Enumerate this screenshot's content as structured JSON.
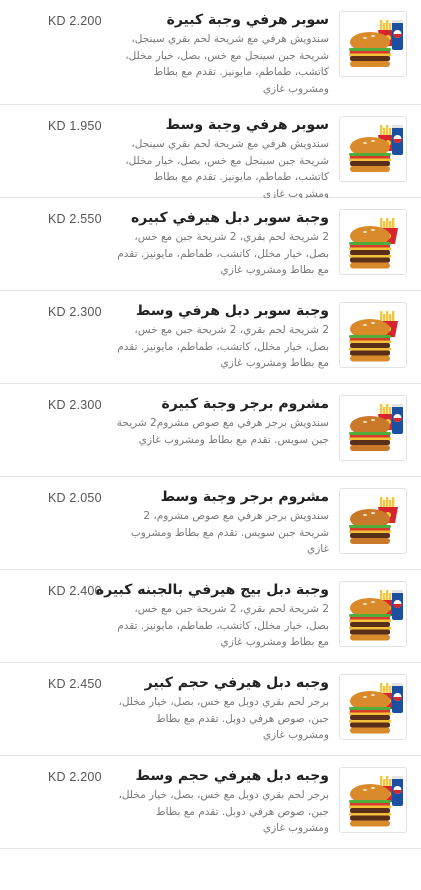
{
  "items": [
    {
      "title": "سوبر هرفي وجبة كبيرة",
      "desc": "سندويش هرفي مع شريحة لحم بقري سينجل، شريحة جبن سينجل مع خس، بصل، خيار مخلل، كاتشب، طماطم، مايونيز. تقدم مع بطاط ومشروب غازي",
      "price": "KD 2.200",
      "image": "burger-combo-large-icon",
      "has_drink": true,
      "bun_color": "#d98a2b",
      "layers": 1
    },
    {
      "title": "سوبر هرفي وجبة وسط",
      "desc": "سندويش هرفي مع شريحة لحم بقري سينجل، شريحة جبن سينجل مع خس، بصل، خيار مخلل، كاتشب، طماطم، مايونيز. تقدم مع بطاط ومشروب غازي",
      "price": "KD 1.950",
      "image": "burger-combo-medium-icon",
      "has_drink": true,
      "bun_color": "#d98a2b",
      "layers": 1
    },
    {
      "title": "وجبة سوبر دبل هيرفي كبيره",
      "desc": "2 شريحة لحم بقري، 2 شريحة جبن مع خس، بصل، خيار مخلل، كاتشب، طماطم، مايونيز. تقدم مع بطاط ومشروب غازي",
      "price": "KD 2.550",
      "image": "double-burger-combo-large-icon",
      "has_drink": false,
      "bun_color": "#d98a2b",
      "layers": 2
    },
    {
      "title": "وجبة سوبر دبل هرفي وسط",
      "desc": "2 شريحة لحم بقري، 2 شريحة جبن مع خس، بصل، خيار مخلل، كاتشب، طماطم، مايونيز. تقدم مع بطاط ومشروب غازي",
      "price": "KD 2.300",
      "image": "double-burger-combo-medium-icon",
      "has_drink": false,
      "bun_color": "#d98a2b",
      "layers": 2
    },
    {
      "title": "مشروم برجر وجبة كبيرة",
      "desc": "سندويش برجر هرفي مع صوص مشروم2 شريحة جبن سويس. تقدم مع بطاط ومشروب غازي",
      "price": "KD 2.300",
      "image": "mushroom-burger-combo-large-icon",
      "has_drink": true,
      "bun_color": "#c9792a",
      "layers": 1
    },
    {
      "title": "مشروم برجر وجبة وسط",
      "desc": "سندويش برجر هرفي مع صوص مشروم، 2 شريحة جبن سويس. تقدم مع بطاط ومشروب غازي",
      "price": "KD 2.050",
      "image": "mushroom-burger-combo-medium-icon",
      "has_drink": false,
      "bun_color": "#c9792a",
      "layers": 1
    },
    {
      "title": "وجبة دبل بيج هيرفي بالجبنه كبيره",
      "desc": "2 شريحة لحم بقري، 2 شريحة جبن مع خس، بصل، خيار مخلل، كاتشب، طماطم، مايونيز. تقدم مع بطاط ومشروب غازي",
      "price": "KD 2.400",
      "image": "double-big-cheese-combo-large-icon",
      "has_drink": true,
      "bun_color": "#d98a2b",
      "layers": 2
    },
    {
      "title": "وجبه دبل هيرفي حجم كبير",
      "desc": "برجر لحم بقري دوبل مع خس، بصل، خيار مخلل، جبن، صوص هرفي دوبل. تقدم مع بطاط ومشروب غازي",
      "price": "KD 2.450",
      "image": "double-herfy-combo-large-icon",
      "has_drink": true,
      "bun_color": "#d98a2b",
      "layers": 2
    },
    {
      "title": "وجبه دبل هيرفي حجم وسط",
      "desc": "برجر لحم بقري دوبل مع خس، بصل، خيار مخلل، جبن، صوص هرفي دوبل. تقدم مع بطاط ومشروب غازي",
      "price": "KD 2.200",
      "image": "double-herfy-combo-medium-icon",
      "has_drink": true,
      "bun_color": "#d98a2b",
      "layers": 2
    }
  ]
}
